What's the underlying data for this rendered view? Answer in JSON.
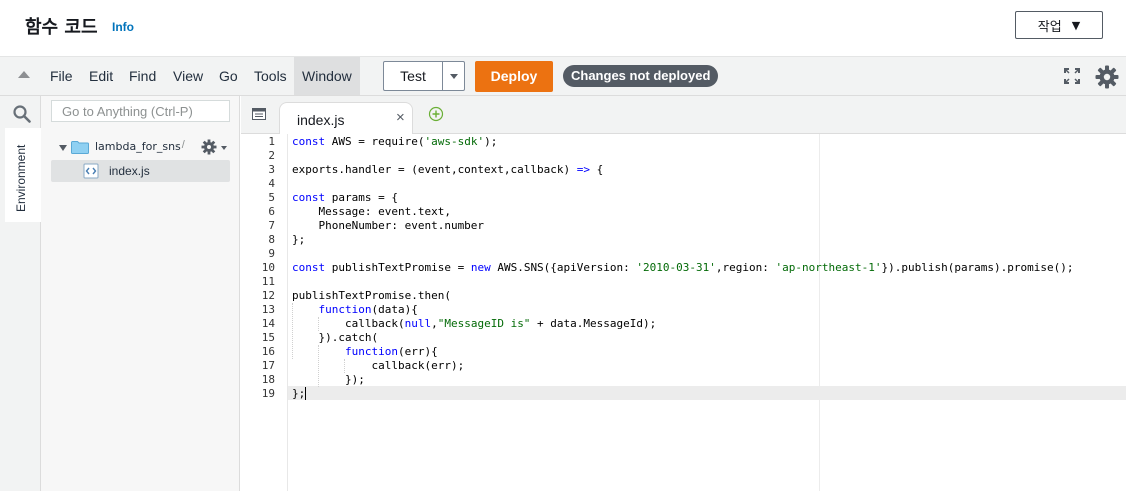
{
  "header": {
    "title": "함수 코드",
    "info": "Info",
    "action_label": "작업"
  },
  "menu": [
    "File",
    "Edit",
    "Find",
    "View",
    "Go",
    "Tools",
    "Window"
  ],
  "toolbar": {
    "test_label": "Test",
    "deploy_label": "Deploy",
    "status_badge": "Changes not deployed"
  },
  "sidebar": {
    "environment_label": "Environment",
    "goto_placeholder": "Go to Anything (Ctrl-P)"
  },
  "tree": {
    "folder_name": "lambda_for_sns",
    "folder_path": "- /",
    "file_name": "index.js"
  },
  "editor": {
    "tab_label": "index.js",
    "lines": [
      "const AWS = require('aws-sdk');",
      "",
      "exports.handler = (event,context,callback) => {",
      "",
      "const params = {",
      "    Message: event.text,",
      "    PhoneNumber: event.number",
      "};",
      "",
      "const publishTextPromise = new AWS.SNS({apiVersion: '2010-03-31',region: 'ap-northeast-1'}).publish(params).promise();",
      "",
      "publishTextPromise.then(",
      "    function(data){",
      "        callback(null,\"MessageID is\" + data.MessageId);",
      "    }).catch(",
      "        function(err){",
      "            callback(err);",
      "        });",
      "};"
    ]
  },
  "colors": {
    "deploy": "#ec7211",
    "badge": "#545b64",
    "link": "#0073bb"
  }
}
